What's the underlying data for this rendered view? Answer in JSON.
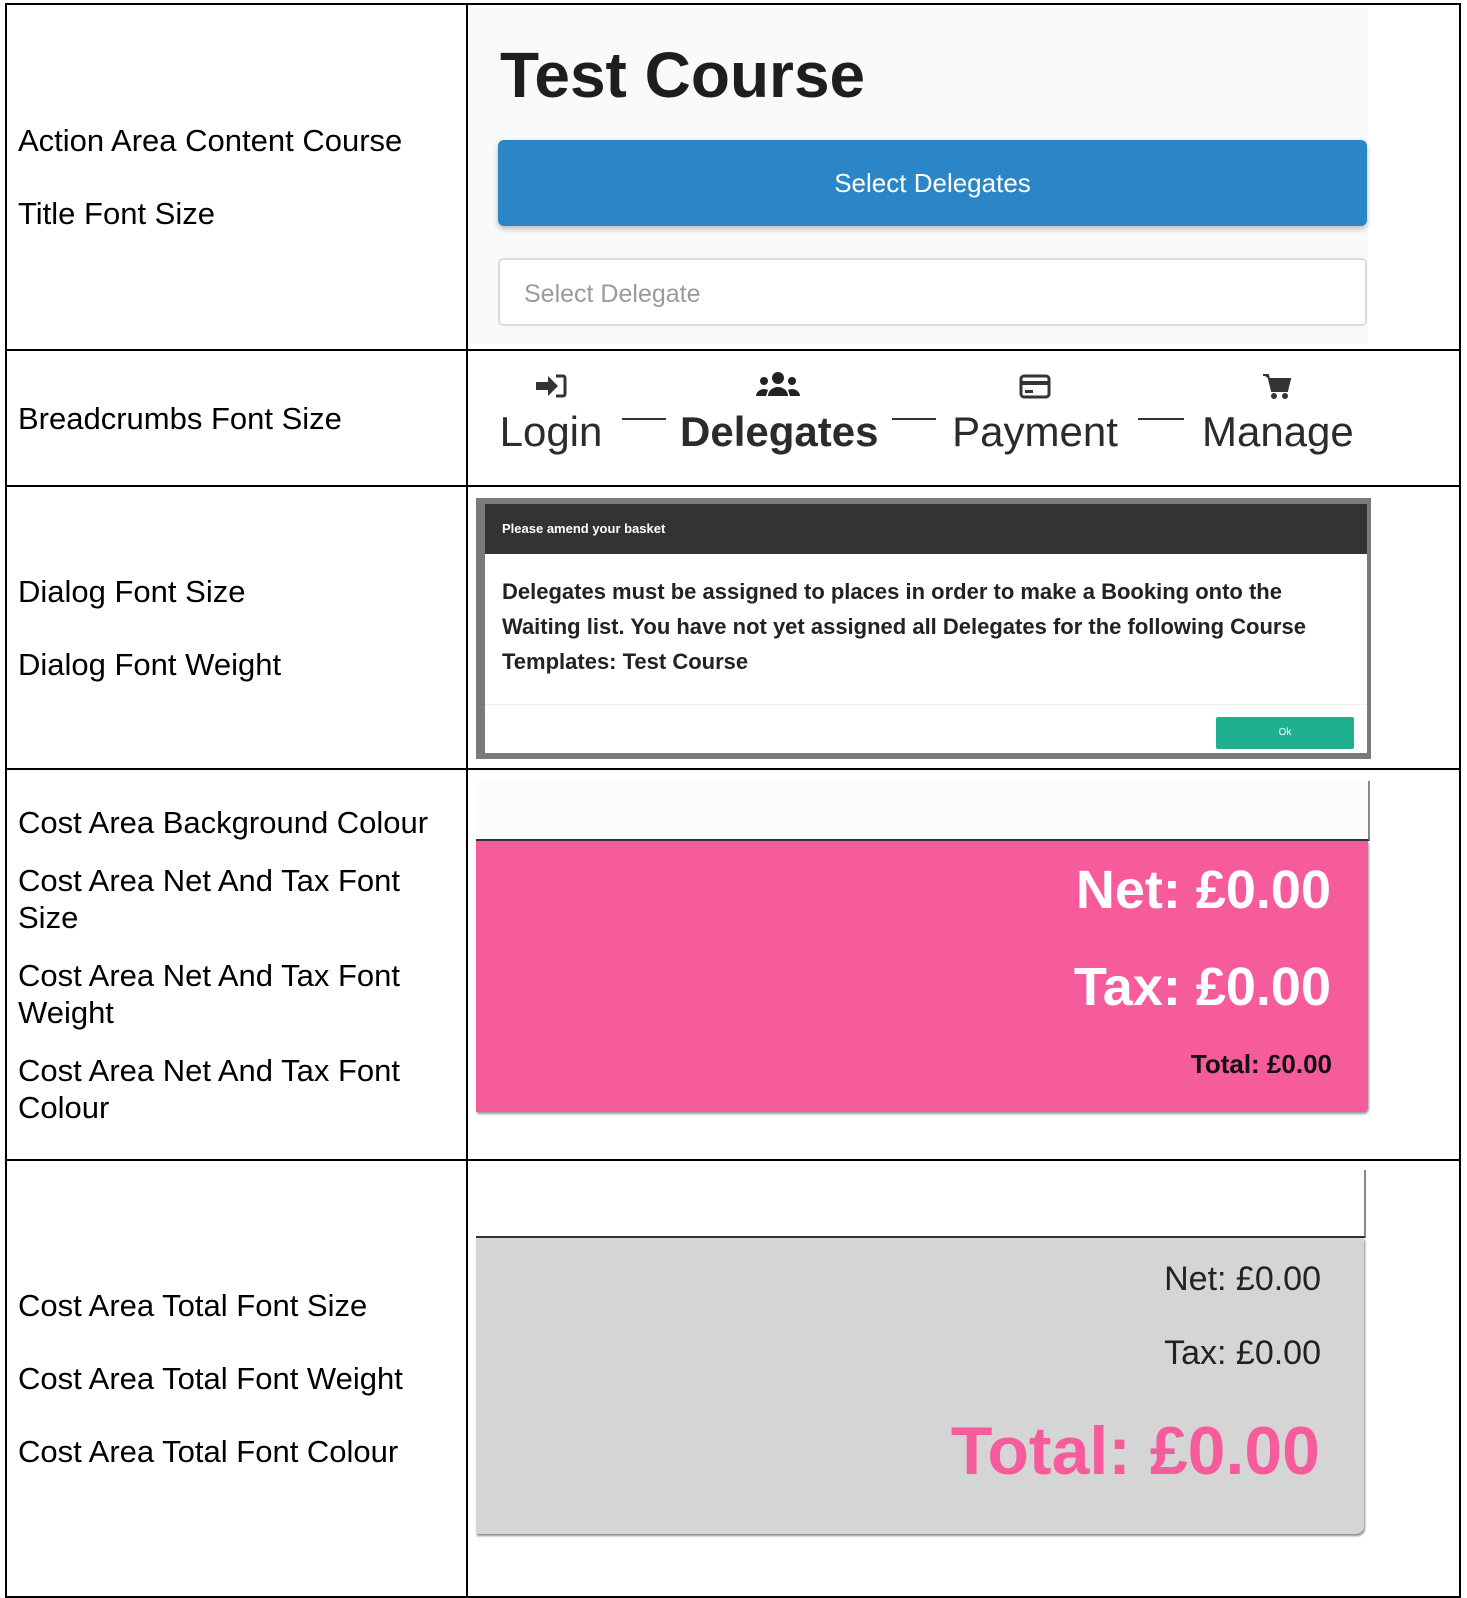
{
  "labels": {
    "row1": [
      "Action Area Content Course",
      "Title Font Size"
    ],
    "row2": [
      "Breadcrumbs Font Size"
    ],
    "row3": [
      "Dialog Font Size",
      "Dialog Font Weight"
    ],
    "row4": [
      "Cost Area Background Colour",
      "Cost Area Net And Tax Font Size",
      "Cost Area Net And Tax Font Weight",
      "Cost Area Net And Tax Font Colour"
    ],
    "row5": [
      "Cost Area Total Font Size",
      "Cost Area Total Font Weight",
      "Cost Area Total Font Colour"
    ]
  },
  "action_area": {
    "course_title": "Test Course",
    "select_button": "Select Delegates",
    "select_placeholder": "Select Delegate"
  },
  "breadcrumbs": {
    "items": [
      {
        "label": "Login",
        "icon": "sign-in-icon",
        "active": false
      },
      {
        "label": "Delegates",
        "icon": "users-icon",
        "active": true
      },
      {
        "label": "Payment",
        "icon": "credit-card-icon",
        "active": false
      },
      {
        "label": "Manage",
        "icon": "cart-icon",
        "active": false
      }
    ]
  },
  "dialog": {
    "title": "Please amend your basket",
    "message": "Delegates must be assigned to places in order to make a Booking onto the Waiting list. You have not yet assigned all Delegates for the following Course Templates: Test Course",
    "ok_label": "Ok"
  },
  "cost_area_pink": {
    "background": "#f65b9c",
    "net": "Net: £0.00",
    "tax": "Tax: £0.00",
    "total": "Total: £0.00"
  },
  "cost_area_grey": {
    "background": "#d5d5d5",
    "total_colour": "#f65b9c",
    "net": "Net: £0.00",
    "tax": "Tax: £0.00",
    "total": "Total: £0.00"
  }
}
